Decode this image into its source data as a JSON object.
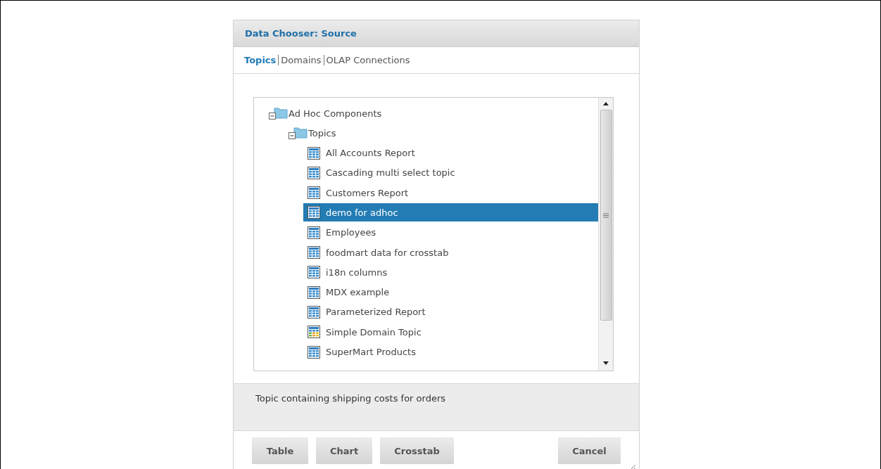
{
  "dialog": {
    "title": "Data Chooser: Source"
  },
  "tabs": [
    {
      "label": "Topics",
      "selected": true
    },
    {
      "label": "Domains",
      "selected": false
    },
    {
      "label": "OLAP Connections",
      "selected": false
    }
  ],
  "tree": [
    {
      "label": "Ad Hoc Components",
      "kind": "folder",
      "expanded": true,
      "selected": false,
      "children": [
        {
          "label": "Topics",
          "kind": "folder",
          "expanded": true,
          "selected": false,
          "children": [
            {
              "label": "All Accounts Report",
              "kind": "topic",
              "selected": false
            },
            {
              "label": "Cascading multi select topic",
              "kind": "topic",
              "selected": false
            },
            {
              "label": "Customers Report",
              "kind": "topic",
              "selected": false
            },
            {
              "label": "demo for adhoc",
              "kind": "topic",
              "selected": true
            },
            {
              "label": "Employees",
              "kind": "topic",
              "selected": false
            },
            {
              "label": "foodmart data for crosstab",
              "kind": "topic",
              "selected": false
            },
            {
              "label": "i18n columns",
              "kind": "topic",
              "selected": false
            },
            {
              "label": "MDX example",
              "kind": "topic",
              "selected": false
            },
            {
              "label": "Parameterized Report",
              "kind": "topic",
              "selected": false
            },
            {
              "label": "Simple Domain Topic",
              "kind": "domain",
              "selected": false
            },
            {
              "label": "SuperMart Products",
              "kind": "topic",
              "selected": false
            }
          ]
        }
      ]
    }
  ],
  "description": "Topic containing shipping costs for orders",
  "buttons": [
    {
      "label": "Table"
    },
    {
      "label": "Chart"
    },
    {
      "label": "Crosstab"
    },
    {
      "label": "Cancel"
    }
  ]
}
